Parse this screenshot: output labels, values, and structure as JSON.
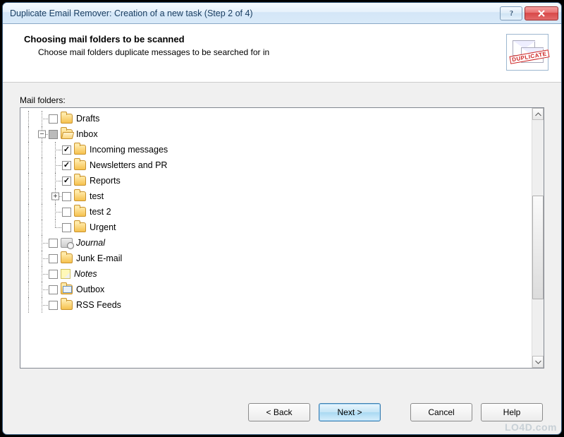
{
  "window": {
    "title": "Duplicate Email Remover: Creation of a new task (Step 2 of 4)"
  },
  "header": {
    "title": "Choosing mail folders to be scanned",
    "subtitle": "Choose mail folders duplicate messages to be searched for in",
    "stamp": "DUPLICATE"
  },
  "labels": {
    "mail_folders": "Mail folders:"
  },
  "tree": [
    {
      "label": "Drafts",
      "level": 2,
      "checked": false,
      "expander": null,
      "icon": "folder",
      "italic": false,
      "conn": [
        "line",
        "tee"
      ]
    },
    {
      "label": "Inbox",
      "level": 2,
      "checked": "mixed",
      "expander": "minus",
      "icon": "folder-open",
      "italic": false,
      "conn": [
        "line",
        "tee"
      ]
    },
    {
      "label": "Incoming messages",
      "level": 3,
      "checked": true,
      "expander": null,
      "icon": "folder",
      "italic": false,
      "conn": [
        "line",
        "line",
        "tee"
      ]
    },
    {
      "label": "Newsletters and PR",
      "level": 3,
      "checked": true,
      "expander": null,
      "icon": "folder",
      "italic": false,
      "conn": [
        "line",
        "line",
        "tee"
      ]
    },
    {
      "label": "Reports",
      "level": 3,
      "checked": true,
      "expander": null,
      "icon": "folder",
      "italic": false,
      "conn": [
        "line",
        "line",
        "tee"
      ]
    },
    {
      "label": "test",
      "level": 3,
      "checked": false,
      "expander": "plus",
      "icon": "folder",
      "italic": false,
      "conn": [
        "line",
        "line",
        "tee"
      ]
    },
    {
      "label": "test 2",
      "level": 3,
      "checked": false,
      "expander": null,
      "icon": "folder",
      "italic": false,
      "conn": [
        "line",
        "line",
        "tee"
      ]
    },
    {
      "label": "Urgent",
      "level": 3,
      "checked": false,
      "expander": null,
      "icon": "folder",
      "italic": false,
      "conn": [
        "line",
        "line",
        "end"
      ]
    },
    {
      "label": "Journal",
      "level": 2,
      "checked": false,
      "expander": null,
      "icon": "journal",
      "italic": true,
      "conn": [
        "line",
        "tee"
      ]
    },
    {
      "label": "Junk E-mail",
      "level": 2,
      "checked": false,
      "expander": null,
      "icon": "folder",
      "italic": false,
      "conn": [
        "line",
        "tee"
      ]
    },
    {
      "label": "Notes",
      "level": 2,
      "checked": false,
      "expander": null,
      "icon": "notes",
      "italic": true,
      "conn": [
        "line",
        "tee"
      ]
    },
    {
      "label": "Outbox",
      "level": 2,
      "checked": false,
      "expander": null,
      "icon": "outbox",
      "italic": false,
      "conn": [
        "line",
        "tee"
      ]
    },
    {
      "label": "RSS Feeds",
      "level": 2,
      "checked": false,
      "expander": null,
      "icon": "folder",
      "italic": false,
      "conn": [
        "line",
        "tee"
      ]
    }
  ],
  "buttons": {
    "back": "< Back",
    "next": "Next >",
    "cancel": "Cancel",
    "help": "Help"
  },
  "watermark": "LO4D.com"
}
